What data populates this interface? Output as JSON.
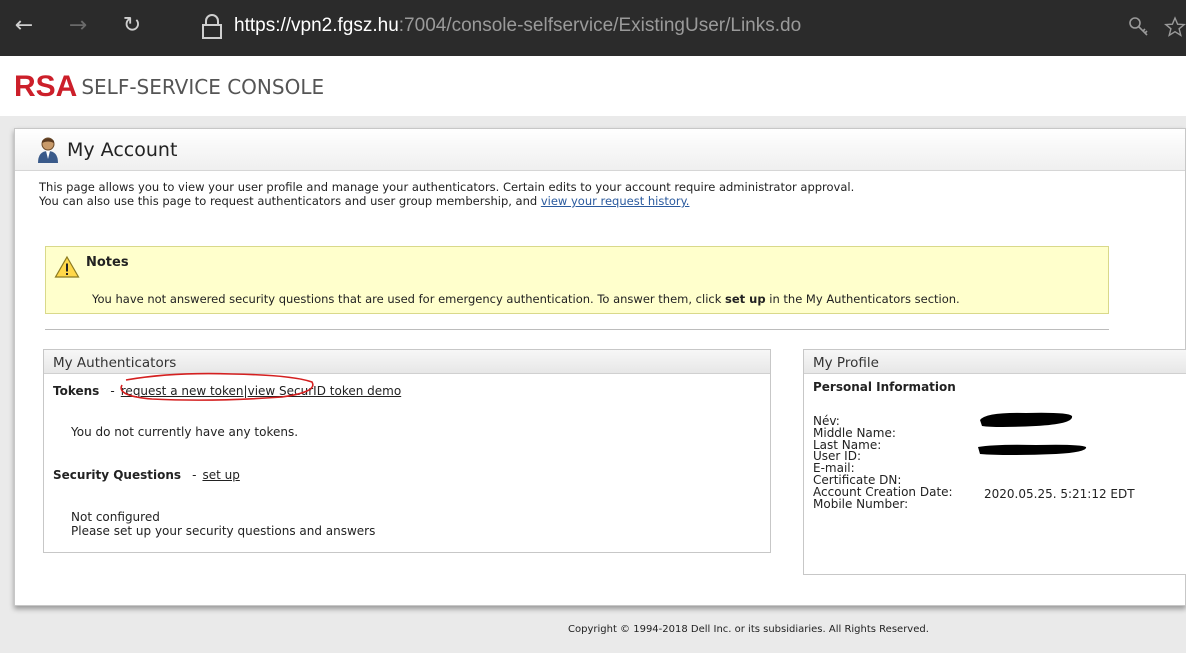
{
  "browser": {
    "url_scheme": "https://",
    "url_host": "vpn2.fgsz.hu",
    "url_rest": ":7004/console-selfservice/ExistingUser/Links.do",
    "back_glyph": "←",
    "forward_glyph": "→",
    "reload_glyph": "↻"
  },
  "header": {
    "logo_rsa": "RSA",
    "logo_text": "SELF-SERVICE CONSOLE"
  },
  "account": {
    "title": "My Account",
    "intro_line1": "This page allows you to view your user profile and manage your authenticators. Certain edits to your account require administrator approval.",
    "intro_line2_prefix": "You can also use this page to request authenticators and user group membership, and ",
    "intro_link": "view your request history."
  },
  "notes": {
    "title": "Notes",
    "text_prefix": "You have not answered security questions that are used for emergency authentication. To answer them, click ",
    "text_bold": "set up",
    "text_suffix": " in the My Authenticators section."
  },
  "authenticators": {
    "title": "My Authenticators",
    "tokens_label": "Tokens",
    "dash": "-",
    "request_token_link": "request a new token",
    "separator": "|",
    "demo_link": "view SecurID token demo",
    "no_tokens": "You do not currently have any tokens.",
    "security_label": "Security Questions",
    "security_dash": "-",
    "setup_link": "set up",
    "not_configured": "Not configured",
    "setup_prompt": "Please set up your security questions and answers"
  },
  "profile": {
    "title": "My Profile",
    "section": "Personal Information",
    "fields": [
      {
        "label": "Név:",
        "value": ""
      },
      {
        "label": "Middle Name:",
        "value": ""
      },
      {
        "label": "Last Name:",
        "value": ""
      },
      {
        "label": "User ID:",
        "value": ""
      },
      {
        "label": "E-mail:",
        "value": ""
      },
      {
        "label": "Certificate DN:",
        "value": ""
      },
      {
        "label": "Account Creation Date:",
        "value": "2020.05.25. 5:21:12 EDT"
      },
      {
        "label": "Mobile Number:",
        "value": ""
      }
    ]
  },
  "footer": {
    "copyright": "Copyright © 1994-2018 Dell Inc. or its subsidiaries. All Rights Reserved."
  },
  "colors": {
    "brand_red": "#cc1f2a",
    "link": "#2a5a9e",
    "notes_bg": "#ffffcc",
    "annotation_red": "#d42020"
  }
}
